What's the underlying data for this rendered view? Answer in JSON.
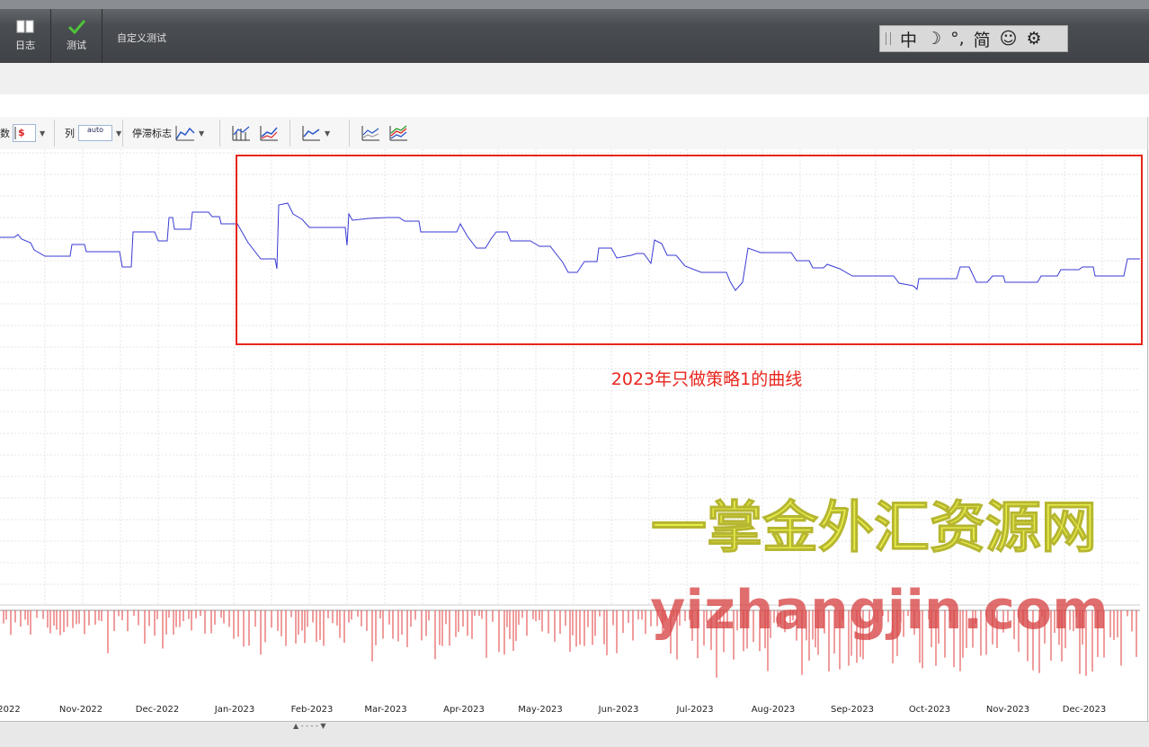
{
  "toolbar": {
    "journal_label": "日志",
    "test_label": "测试",
    "custom_test_label": "自定义测试"
  },
  "ime": {
    "items": [
      "中",
      "☽",
      "°,",
      "简",
      "☺",
      "⚙"
    ]
  },
  "chart_toolbar": {
    "unit_label": "数",
    "column_label": "列",
    "column_mini": "auto",
    "stagnation_label": "停滞标志"
  },
  "annotation": {
    "caption": "2023年只做策略1的曲线"
  },
  "watermark": {
    "cn": "一掌金外汇资源网",
    "url": "yizhangjin.com"
  },
  "chart_data": {
    "type": "line",
    "x_tick_labels": [
      "2022",
      "Nov-2022",
      "Dec-2022",
      "Jan-2023",
      "Feb-2023",
      "Mar-2023",
      "Apr-2023",
      "May-2023",
      "Jun-2023",
      "Jul-2023",
      "Aug-2023",
      "Sep-2023",
      "Oct-2023",
      "Nov-2023",
      "Dec-2023"
    ],
    "equity_series_color": "#3a3ad6",
    "bar_series_color": "#e23b3b",
    "grid": true,
    "highlight_color": "#e8261e"
  }
}
